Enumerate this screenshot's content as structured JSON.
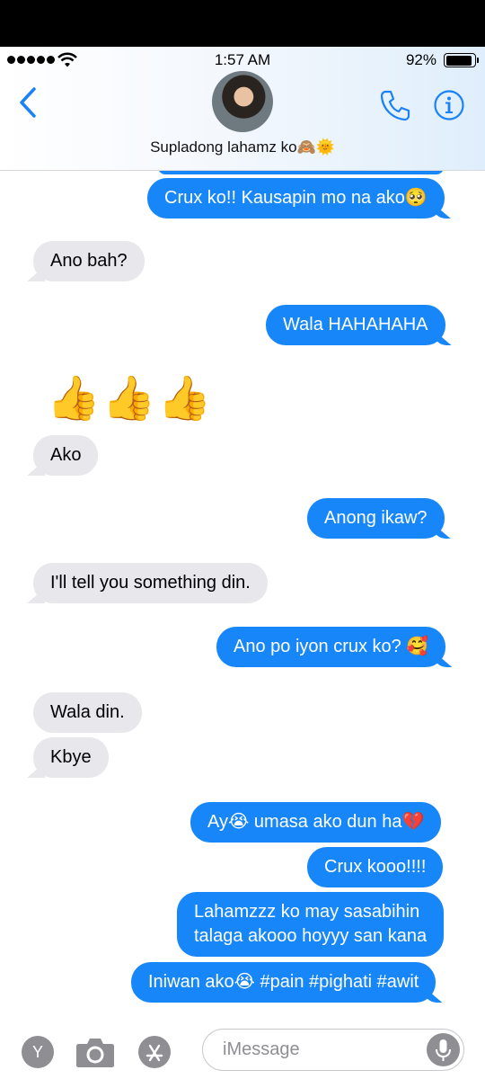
{
  "status": {
    "time": "1:57 AM",
    "battery_text": "92%"
  },
  "header": {
    "contact_name": "Supladong lahamz ko🙈🌞"
  },
  "messages": [
    {
      "side": "sent",
      "text": "Crux ko!! Kausapin mo na ako🥺"
    },
    {
      "side": "recv",
      "text": "Ano bah?"
    },
    {
      "side": "sent",
      "text": "Wala HAHAHAHA"
    },
    {
      "side": "recv",
      "text": "👍👍👍",
      "big_emoji": true
    },
    {
      "side": "recv",
      "text": "Ako"
    },
    {
      "side": "sent",
      "text": "Anong ikaw?"
    },
    {
      "side": "recv",
      "text": "I'll tell you something din."
    },
    {
      "side": "sent",
      "text": "Ano po iyon crux ko? 🥰"
    },
    {
      "side": "recv",
      "text": "Wala din."
    },
    {
      "side": "recv",
      "text": "Kbye"
    },
    {
      "side": "sent",
      "text": "Ay😭 umasa ako dun ha💔"
    },
    {
      "side": "sent",
      "text": "Crux kooo!!!!"
    },
    {
      "side": "sent",
      "text": "Lahamzzz ko may sasabihin\ntalaga akooo hoyyy san kana"
    },
    {
      "side": "sent",
      "text": "Iniwan ako😭 #pain #pighati #awit"
    }
  ],
  "composer": {
    "placeholder": "iMessage",
    "app_button_label": "Y"
  },
  "icons": {
    "back": "chevron-left-icon",
    "phone": "phone-icon",
    "info": "info-icon",
    "camera": "camera-icon",
    "app_store": "app-store-icon",
    "mic": "microphone-icon"
  },
  "colors": {
    "sent_bubble": "#1786f9",
    "received_bubble": "#e7e7ec",
    "accent": "#1a82f7"
  }
}
